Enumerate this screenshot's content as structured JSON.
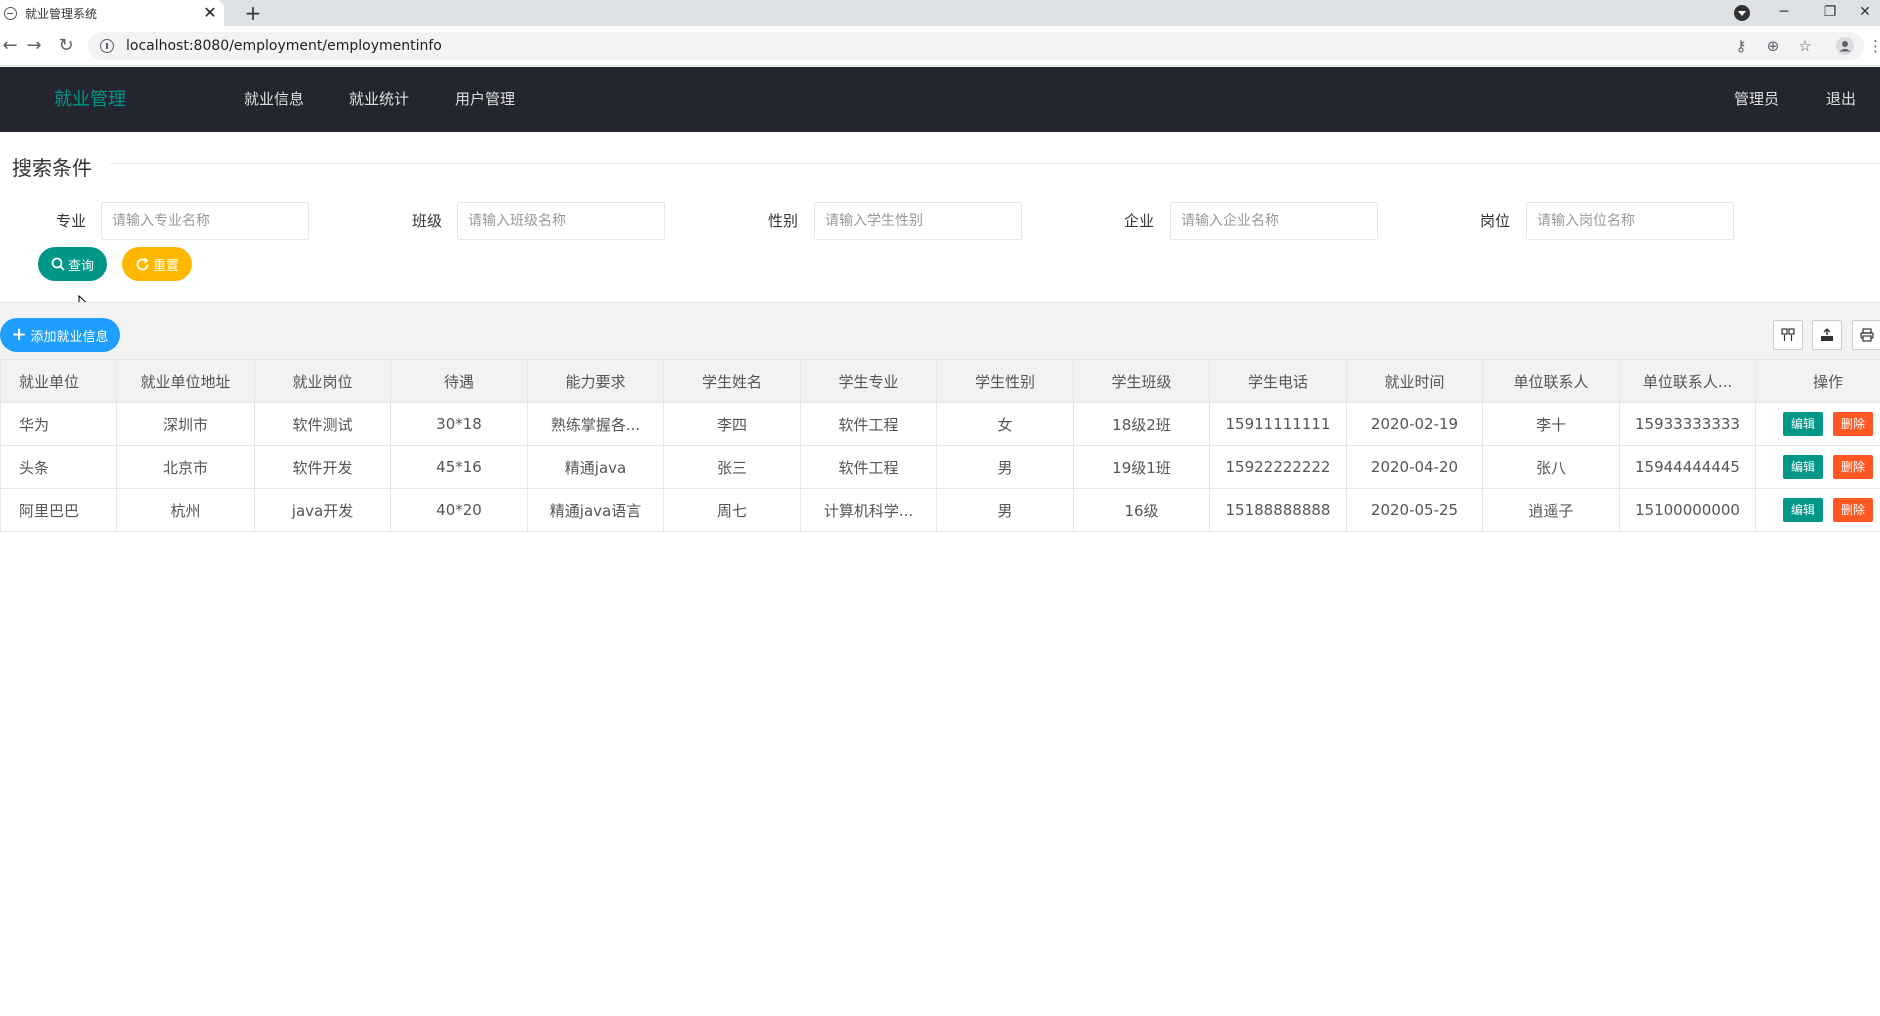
{
  "browser": {
    "tab_title": "就业管理系统",
    "tab_close": "✕",
    "new_tab": "+",
    "url": "localhost:8080/employment/employmentinfo",
    "window_minimize": "─",
    "window_restore": "❐",
    "window_close": "✕"
  },
  "header": {
    "logo": "就业管理",
    "nav": [
      "就业信息",
      "就业统计",
      "用户管理"
    ],
    "user": "管理员",
    "logout": "退出"
  },
  "search": {
    "legend": "搜索条件",
    "fields": [
      {
        "label": "专业",
        "placeholder": "请输入专业名称"
      },
      {
        "label": "班级",
        "placeholder": "请输入班级名称"
      },
      {
        "label": "性别",
        "placeholder": "请输入学生性别"
      },
      {
        "label": "企业",
        "placeholder": "请输入企业名称"
      },
      {
        "label": "岗位",
        "placeholder": "请输入岗位名称"
      }
    ],
    "search_button": "查询",
    "reset_button": "重置"
  },
  "toolbar": {
    "add_button": "添加就业信息"
  },
  "table": {
    "columns": [
      "就业单位",
      "就业单位地址",
      "就业岗位",
      "待遇",
      "能力要求",
      "学生姓名",
      "学生专业",
      "学生性别",
      "学生班级",
      "学生电话",
      "就业时间",
      "单位联系人",
      "单位联系人...",
      "操作"
    ],
    "rows": [
      [
        "华为",
        "深圳市",
        "软件测试",
        "30*18",
        "熟练掌握各...",
        "李四",
        "软件工程",
        "女",
        "18级2班",
        "15911111111",
        "2020-02-19",
        "李十",
        "15933333333"
      ],
      [
        "头条",
        "北京市",
        "软件开发",
        "45*16",
        "精通java",
        "张三",
        "软件工程",
        "男",
        "19级1班",
        "15922222222",
        "2020-04-20",
        "张八",
        "15944444445"
      ],
      [
        "阿里巴巴",
        "杭州",
        "java开发",
        "40*20",
        "精通java语言",
        "周七",
        "计算机科学...",
        "男",
        "16级",
        "15188888888",
        "2020-05-25",
        "逍遥子",
        "15100000000"
      ]
    ],
    "edit_label": "编辑",
    "delete_label": "删除"
  },
  "colors": {
    "header_bg": "#23262e",
    "logo": "#009688",
    "primary": "#009688",
    "warm": "#ffb800",
    "normal": "#1e9fff",
    "danger": "#ff5722"
  },
  "icons": {
    "tab_favicon": "globe-icon",
    "back": "arrow-left-icon",
    "forward": "arrow-right-icon",
    "reload": "reload-icon",
    "site_info": "info-icon",
    "key": "key-icon",
    "zoom": "zoom-icon",
    "bookmark": "star-icon",
    "account": "account-icon",
    "menu": "kebab-menu-icon",
    "search": "search-icon",
    "reset": "refresh-icon",
    "add": "plus-icon",
    "columns": "columns-icon",
    "export": "export-icon",
    "print": "print-icon"
  }
}
